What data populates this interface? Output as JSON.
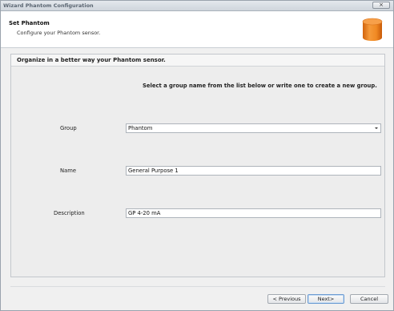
{
  "window": {
    "title": "Wizard Phantom Configuration",
    "close_label": "×"
  },
  "header": {
    "title": "Set Phantom",
    "subtitle": "Configure your Phantom sensor.",
    "icon": "orange-cylinder-icon"
  },
  "panel": {
    "title": "Organize in a better way your Phantom sensor.",
    "instruction": "Select a group name from the list below or write one to create a new group."
  },
  "form": {
    "group_label": "Group",
    "group_value": "Phantom",
    "name_label": "Name",
    "name_value": "General Purpose 1",
    "description_label": "Description",
    "description_value": "GP 4-20 mA"
  },
  "buttons": {
    "previous": "< Previous",
    "next": "Next>",
    "cancel": "Cancel"
  },
  "colors": {
    "accent_orange": "#f08a24",
    "panel_bg": "#ededed",
    "header_bg": "#ffffff"
  }
}
